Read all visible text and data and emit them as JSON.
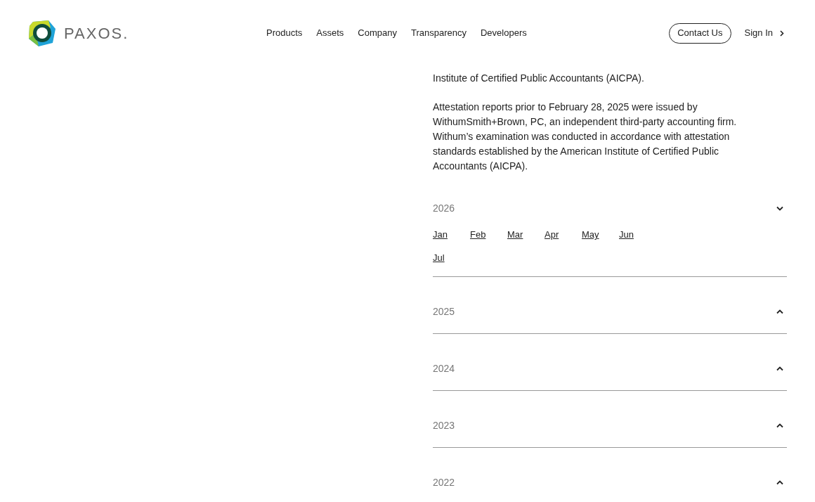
{
  "header": {
    "logo_text": "PAXOS.",
    "nav": [
      "Products",
      "Assets",
      "Company",
      "Transparency",
      "Developers"
    ],
    "contact_button": "Contact Us",
    "sign_in": "Sign In"
  },
  "paragraphs": [
    "Institute of Certified Public Accountants (AICPA).",
    "Attestation reports prior to February 28, 2025 were issued by WithumSmith+Brown, PC, an independent third-party accounting firm. Withum’s examination was conducted in accordance with attestation standards established by the American Institute of Certified Public Accountants (AICPA)."
  ],
  "years": [
    {
      "label": "2026",
      "expanded": true,
      "months": [
        "Jan",
        "Feb",
        "Mar",
        "Apr",
        "May",
        "Jun",
        "Jul"
      ]
    },
    {
      "label": "2025",
      "expanded": false
    },
    {
      "label": "2024",
      "expanded": false
    },
    {
      "label": "2023",
      "expanded": false
    },
    {
      "label": "2022",
      "expanded": false
    }
  ]
}
